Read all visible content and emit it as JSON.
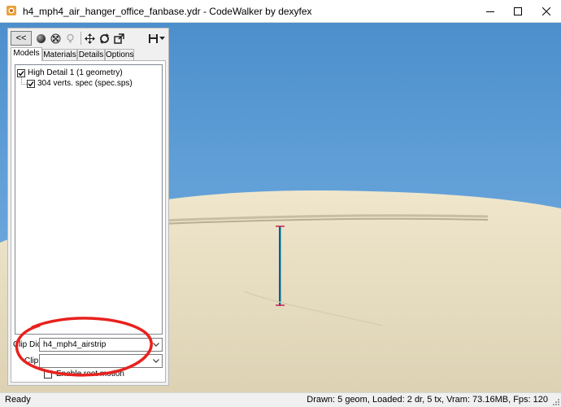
{
  "window": {
    "title": "h4_mph4_air_hanger_office_fanbase.ydr - CodeWalker by dexyfex"
  },
  "toolbar": {
    "collapse_label": "<<"
  },
  "tabs": [
    {
      "label": "Models"
    },
    {
      "label": "Materials"
    },
    {
      "label": "Details"
    },
    {
      "label": "Options"
    }
  ],
  "models_tree": {
    "root": {
      "label": "High Detail 1 (1 geometry)",
      "checked": true
    },
    "child": {
      "label": "304 verts. spec (spec.sps)",
      "checked": true
    }
  },
  "clip_dict": {
    "label": "Clip Dict:",
    "value": "h4_mph4_airstrip"
  },
  "clip": {
    "label": "Clip:",
    "value": ""
  },
  "enable_root_motion": {
    "label": "Enable root motion",
    "checked": false
  },
  "status": {
    "left": "Ready",
    "right": "Drawn: 5 geom, Loaded: 2 dr, 5 tx, Vram: 73.16MB, Fps: 120"
  },
  "colors": {
    "sky": "#5e9dd6",
    "ground": "#e6dcc0",
    "annotation_circle": "#e8211e"
  }
}
